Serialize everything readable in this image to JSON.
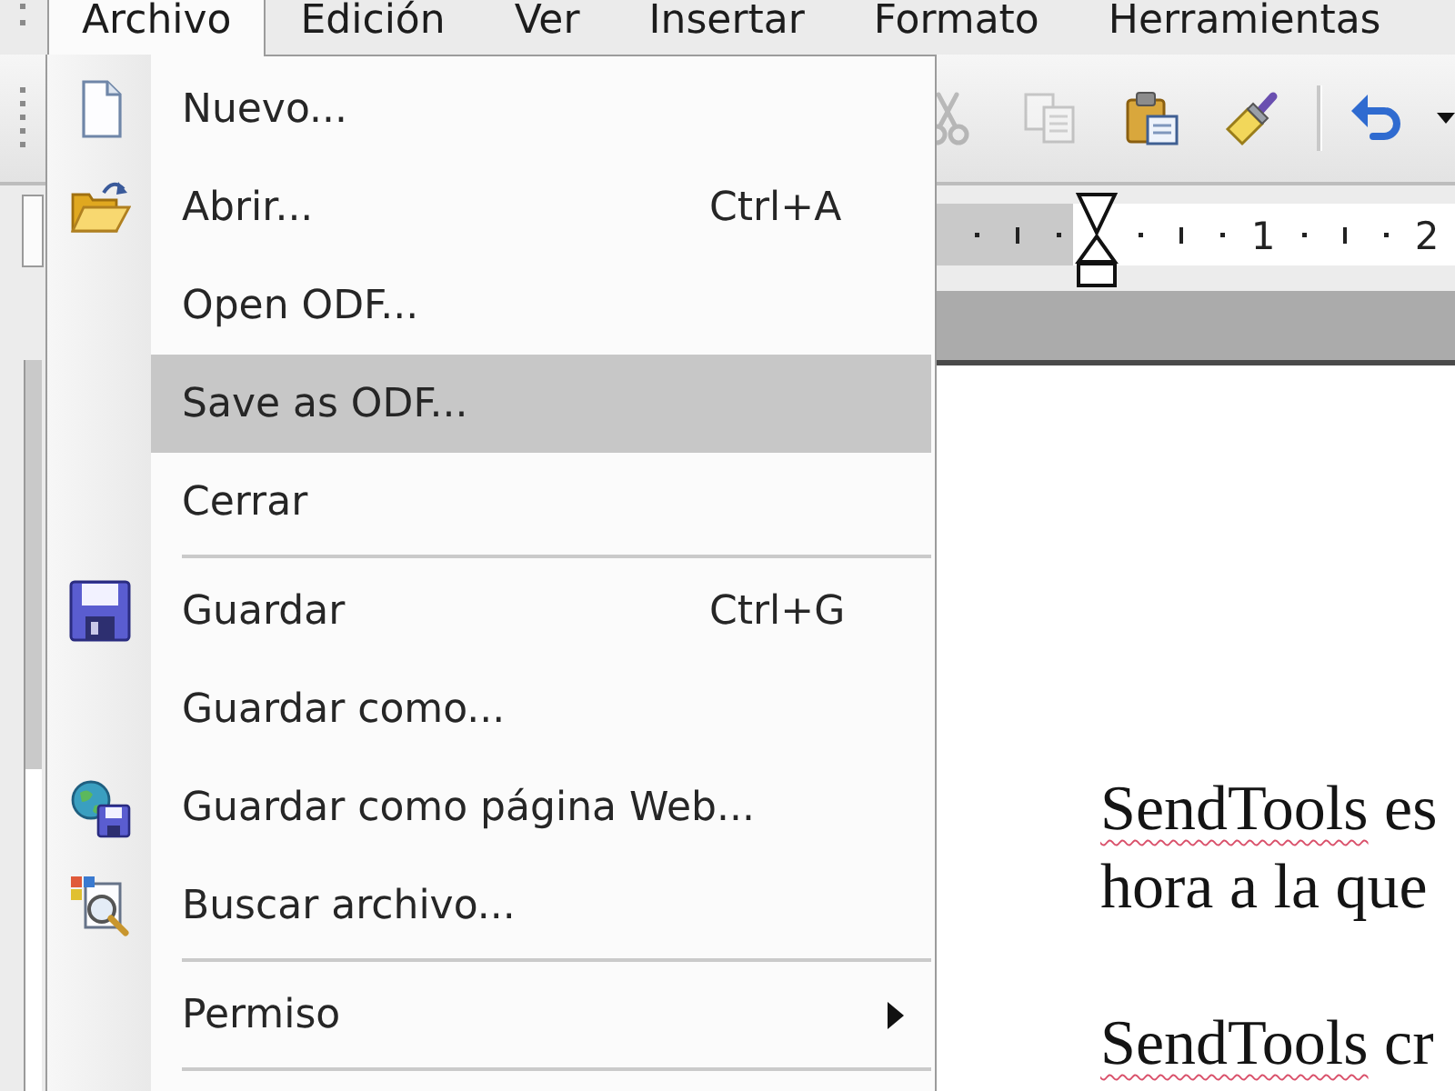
{
  "menu_bar": {
    "items": [
      {
        "label": "Archivo",
        "selected": true
      },
      {
        "label": "Edición",
        "selected": false
      },
      {
        "label": "Ver",
        "selected": false
      },
      {
        "label": "Insertar",
        "selected": false
      },
      {
        "label": "Formato",
        "selected": false
      },
      {
        "label": "Herramientas",
        "selected": false
      }
    ]
  },
  "toolbar": {
    "buttons": [
      {
        "kind": "cut",
        "disabled": true
      },
      {
        "kind": "copy",
        "disabled": true
      },
      {
        "kind": "paste",
        "disabled": false
      },
      {
        "kind": "format_painter",
        "disabled": false
      },
      {
        "kind": "separator"
      },
      {
        "kind": "undo",
        "disabled": false
      },
      {
        "kind": "dropdown",
        "disabled": false
      }
    ]
  },
  "ruler": {
    "labels": [
      "1",
      "2"
    ]
  },
  "file_menu": {
    "groups": [
      {
        "items": [
          {
            "kind": "new",
            "label": "Nuevo...",
            "selected": false
          },
          {
            "kind": "open",
            "label": "Abrir...",
            "shortcut": "Ctrl+A",
            "selected": false
          },
          {
            "kind": "plain",
            "label": "Open ODF...",
            "selected": false
          },
          {
            "kind": "plain",
            "label": "Save as ODF...",
            "selected": true
          },
          {
            "kind": "plain",
            "label": "Cerrar",
            "selected": false
          }
        ]
      },
      {
        "items": [
          {
            "kind": "save",
            "label": "Guardar",
            "shortcut": "Ctrl+G",
            "selected": false
          },
          {
            "kind": "plain",
            "label": "Guardar como...",
            "selected": false
          },
          {
            "kind": "web_page",
            "label": "Guardar como página Web...",
            "selected": false
          },
          {
            "kind": "search",
            "label": "Buscar archivo...",
            "selected": false
          }
        ]
      },
      {
        "items": [
          {
            "kind": "submenu",
            "label": "Permiso",
            "selected": false
          }
        ]
      }
    ]
  },
  "document": {
    "paragraphs": [
      {
        "lines": [
          {
            "runs": [
              {
                "text": "SendTools",
                "misspelled": true
              },
              {
                "text": "es",
                "misspelled": false
              }
            ]
          },
          {
            "runs": [
              {
                "text": "hora a la que",
                "misspelled": false
              }
            ]
          }
        ]
      },
      {
        "lines": [
          {
            "runs": [
              {
                "text": "SendTools",
                "misspelled": true
              },
              {
                "text": "cr",
                "misspelled": false
              }
            ]
          }
        ]
      }
    ]
  }
}
